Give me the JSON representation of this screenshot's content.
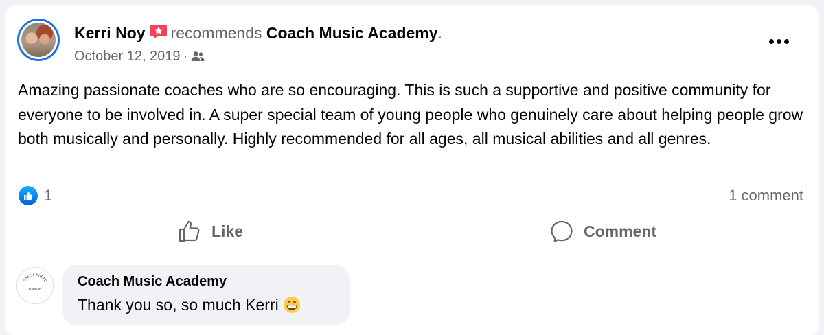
{
  "post": {
    "author": "Kerri Noy",
    "recommends_text": "recommends",
    "page_name": "Coach Music Academy",
    "period": ".",
    "date": "October 12, 2019",
    "meta_separator": "·",
    "body": "Amazing passionate coaches who are so encouraging. This is such a supportive and positive community for everyone to be involved in. A super special team of young people who genuinely care about helping people grow both musically and personally. Highly recommended for all ages, all musical abilities and all genres.",
    "icons": {
      "recommendation": "star-badge-icon",
      "audience": "friends-icon",
      "more": "more-options-icon"
    },
    "colors": {
      "recommend_badge": "#f3425f",
      "like_blue": "#1b74e4",
      "secondary_text": "#65676b"
    }
  },
  "reactions": {
    "like_count": "1",
    "comment_count": "1 comment"
  },
  "actions": {
    "like_label": "Like",
    "comment_label": "Comment"
  },
  "comment": {
    "author": "Coach Music Academy",
    "text": "Thank you so, so much Kerri",
    "emoji": "grinning-face-icon",
    "avatar_logo_text": "COACH MUSIC ACADEMY"
  }
}
